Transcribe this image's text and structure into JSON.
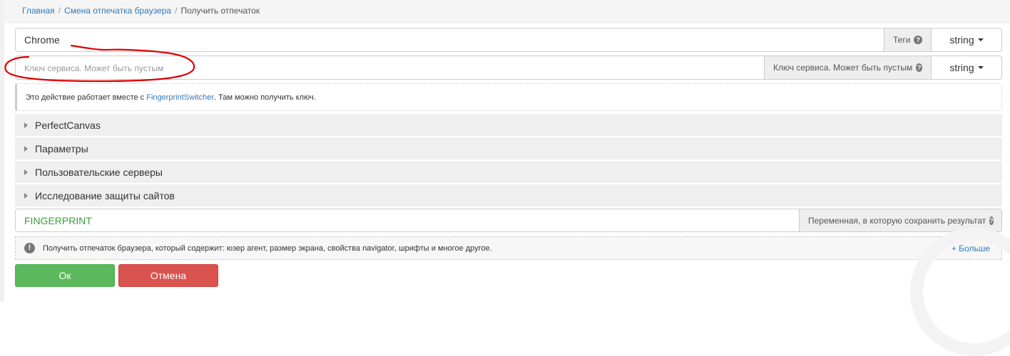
{
  "breadcrumb": {
    "home": "Главная",
    "section": "Смена отпечатка браузера",
    "current": "Получить отпечаток",
    "separator": "/"
  },
  "tags_field": {
    "value": "Chrome",
    "addon_label": "Теги",
    "type_label": "string"
  },
  "service_key_field": {
    "value": "",
    "placeholder": "Ключ сервиса. Может быть пустым",
    "addon_label": "Ключ сервиса. Может быть пустым",
    "type_label": "string"
  },
  "info": {
    "text_before": "Это действие работает вместе с ",
    "link_text": "FingerprintSwitcher",
    "text_after": ". Там можно получить ключ."
  },
  "sections": [
    {
      "label": "PerfectCanvas"
    },
    {
      "label": "Параметры"
    },
    {
      "label": "Пользовательские серверы"
    },
    {
      "label": "Исследование защиты сайтов"
    }
  ],
  "result_field": {
    "value": "FINGERPRINT",
    "addon_label": "Переменная, в которую сохранить результат"
  },
  "description": {
    "text": "Получить отпечаток браузера, который содержит: юзер агент, размер экрана, свойства navigator, шрифты и многое другое.",
    "more_label": "+ Больше"
  },
  "buttons": {
    "ok": "Ок",
    "cancel": "Отмена"
  },
  "colors": {
    "ok": "#5cb85c",
    "cancel": "#d9534f",
    "link": "#337ab7",
    "variable_text": "#3c9c3c",
    "annotation": "#e00000"
  },
  "icons": {
    "help": "question-circle-icon",
    "collapse": "caret-right-icon",
    "dropdown": "caret-down-icon",
    "note": "exclamation-circle-icon"
  }
}
